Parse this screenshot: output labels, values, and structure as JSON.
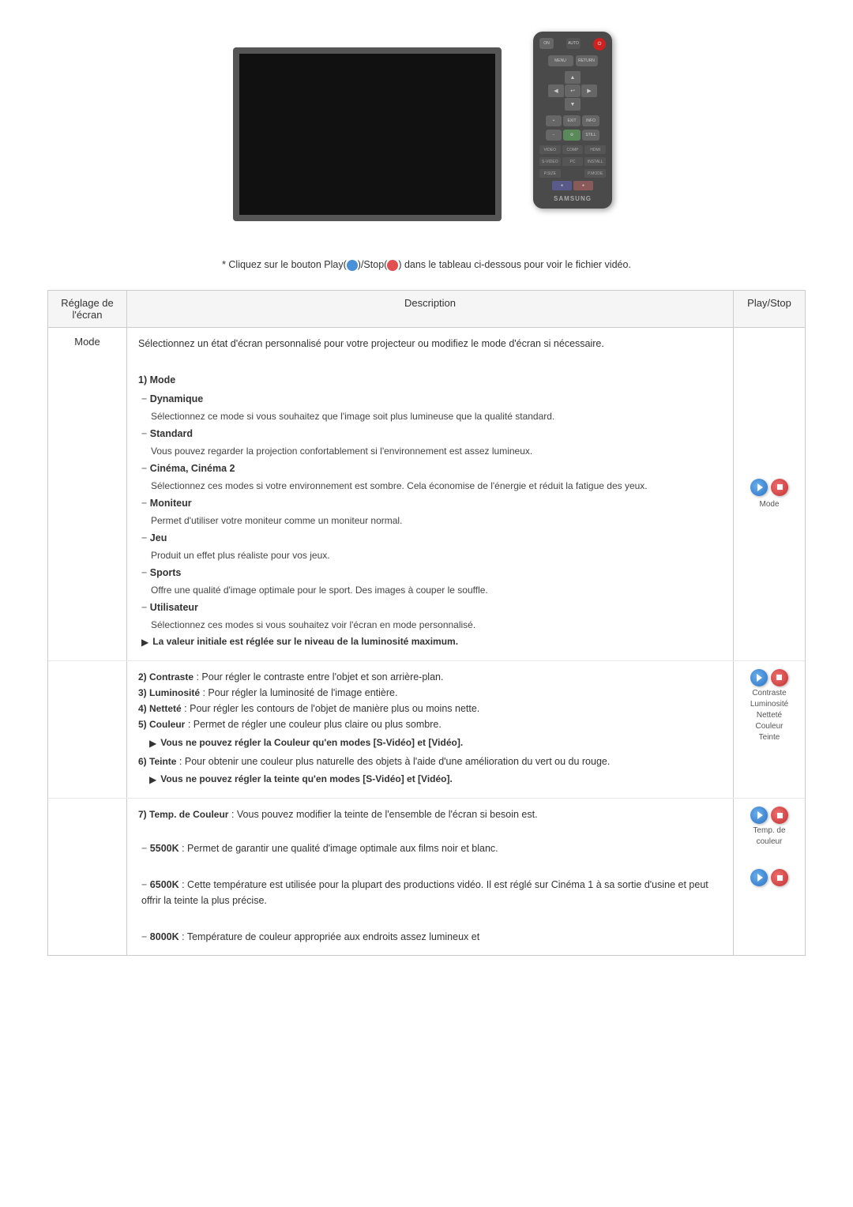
{
  "header": {
    "instruction": "* Cliquez sur le bouton Play(",
    "instruction_mid": ")/Stop(",
    "instruction_end": ") dans le tableau ci-dessous pour voir le fichier vidéo."
  },
  "table": {
    "col1": "Réglage de l'écran",
    "col2": "Description",
    "col3": "Play/Stop",
    "row_mode": {
      "label": "Mode",
      "intro": "Sélectionnez un état d'écran personnalisé pour votre projecteur ou modifiez le mode d'écran si nécessaire.",
      "section1_title": "1) Mode",
      "items": [
        {
          "name": "Dynamique",
          "desc": "Sélectionnez ce mode si vous souhaitez que l'image soit plus lumineuse que la qualité standard."
        },
        {
          "name": "Standard",
          "desc": "Vous pouvez regarder la projection confortablement si l'environnement est assez lumineux."
        },
        {
          "name": "Cinéma, Cinéma 2",
          "desc": "Sélectionnez ces modes si votre environnement est sombre. Cela économise de l'énergie et réduit la fatigue des yeux."
        },
        {
          "name": "Moniteur",
          "desc": "Permet d'utiliser votre moniteur comme un moniteur normal."
        },
        {
          "name": "Jeu",
          "desc": "Produit un effet plus réaliste pour vos jeux."
        },
        {
          "name": "Sports",
          "desc": "Offre une qualité d'image optimale pour le sport. Des images à couper le souffle."
        },
        {
          "name": "Utilisateur",
          "desc": "Sélectionnez ces modes si vous souhaitez voir l'écran en mode personnalisé."
        }
      ],
      "bullet": "La valeur initiale est réglée sur le niveau de la luminosité maximum.",
      "play_label": "Mode"
    },
    "row_settings": {
      "items": [
        {
          "num": "2)",
          "name": "Contraste",
          "desc": "Pour régler le contraste entre l'objet et son arrière-plan."
        },
        {
          "num": "3)",
          "name": "Luminosité",
          "desc": "Pour régler la luminosité de l'image entière."
        },
        {
          "num": "4)",
          "name": "Netteté",
          "desc": "Pour régler les contours de l'objet de manière plus ou moins nette."
        },
        {
          "num": "5)",
          "name": "Couleur",
          "desc": "Permet de régler une couleur plus claire ou plus sombre."
        },
        {
          "num": "6)",
          "name": "Teinte",
          "desc": "Pour obtenir une couleur plus naturelle des objets à l'aide d'une amélioration du vert ou du rouge."
        }
      ],
      "bullet_couleur": "Vous ne pouvez régler la Couleur qu'en modes [S-Vidéo] et [Vidéo].",
      "bullet_teinte": "Vous ne pouvez régler la teinte qu'en modes [S-Vidéo] et [Vidéo].",
      "labels": [
        "Contraste",
        "Luminosité",
        "Netteté",
        "Couleur",
        "Teinte"
      ]
    },
    "row_temp": {
      "intro": "7) Temp. de Couleur  : Vous pouvez modifier la teinte de l'ensemble de l'écran si besoin est.",
      "items": [
        {
          "val": "5500K",
          "desc": "Permet de garantir une qualité d'image optimale aux films noir et blanc."
        },
        {
          "val": "6500K",
          "desc": "Cette température est utilisée pour la plupart des productions vidéo. Il est réglé sur Cinéma 1 à sa sortie d'usine et peut offrir la teinte la plus précise."
        },
        {
          "val": "8000K",
          "desc": "Température de couleur appropriée aux endroits assez lumineux et"
        }
      ],
      "label": "Temp. de couleur"
    }
  }
}
